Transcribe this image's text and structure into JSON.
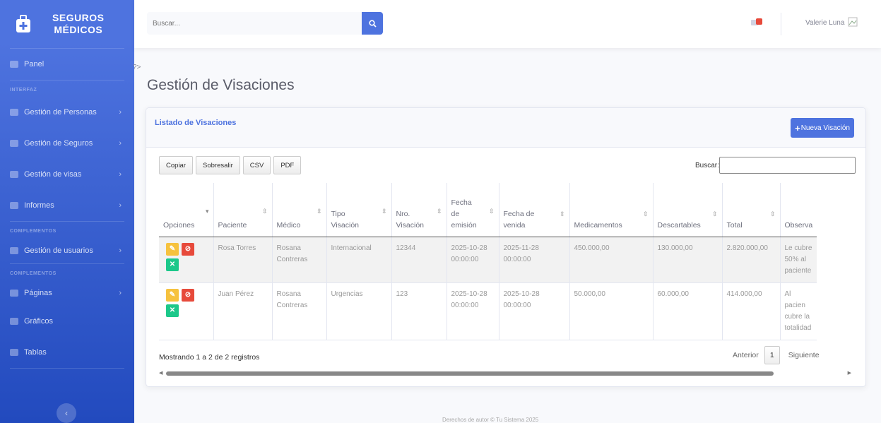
{
  "brand": {
    "line1": "SEGUROS",
    "line2": "MÉDICOS"
  },
  "sidebar": {
    "panel": "Panel",
    "heading_interfaz": "INTERFAZ",
    "items_interfaz": [
      {
        "label": "Gestión de Personas"
      },
      {
        "label": "Gestión de Seguros"
      },
      {
        "label": "Gestión de visas"
      },
      {
        "label": "Informes"
      }
    ],
    "heading_complementos1": "COMPLEMENTOS",
    "usuarios": "Gestión de usuarios",
    "heading_complementos2": "COMPLEMENTOS",
    "paginas": "Páginas",
    "graficos": "Gráficos",
    "tablas": "Tablas",
    "chevron": "›",
    "toggle": "‹"
  },
  "topbar": {
    "search_placeholder": "Buscar...",
    "username": "Valerie Luna"
  },
  "stray_text": "?>",
  "page_title": "Gestión de Visaciones",
  "card": {
    "title": "Listado de Visaciones",
    "new_button": "Nueva Visación",
    "new_button_icon": "+"
  },
  "dt": {
    "buttons": [
      "Copiar",
      "Sobresalir",
      "CSV",
      "PDF"
    ],
    "search_label": "Buscar:",
    "info": "Mostrando 1 a 2 de 2 registros",
    "prev": "Anterior",
    "page": "1",
    "next": "Siguiente"
  },
  "table": {
    "headers": [
      "Opciones",
      "Paciente",
      "Médico",
      "Tipo Visación",
      "Nro. Visación",
      "Fecha de emisión",
      "Fecha de venida",
      "Medicamentos",
      "Descartables",
      "Total",
      "Observa"
    ],
    "rows": [
      [
        "",
        "Rosa Torres",
        "Rosana Contreras",
        "Internacional",
        "12344",
        "2025-10-28 00:00:00",
        "2025-11-28 00:00:00",
        "450.000,00",
        "130.000,00",
        "2.820.000,00",
        "Le cubre 50% al paciente"
      ],
      [
        "",
        "Juan Pérez",
        "Rosana Contreras",
        "Urgencias",
        "123",
        "2025-10-28 00:00:00",
        "2025-10-28 00:00:00",
        "50.000,00",
        "60.000,00",
        "414.000,00",
        "Al pacien cubre la totalidad"
      ]
    ]
  },
  "footer": "Derechos de autor © Tu Sistema 2025",
  "colors": {
    "primary": "#4e73df",
    "danger": "#e74a3b",
    "warning": "#f6c23e",
    "success": "#1cc88a"
  }
}
